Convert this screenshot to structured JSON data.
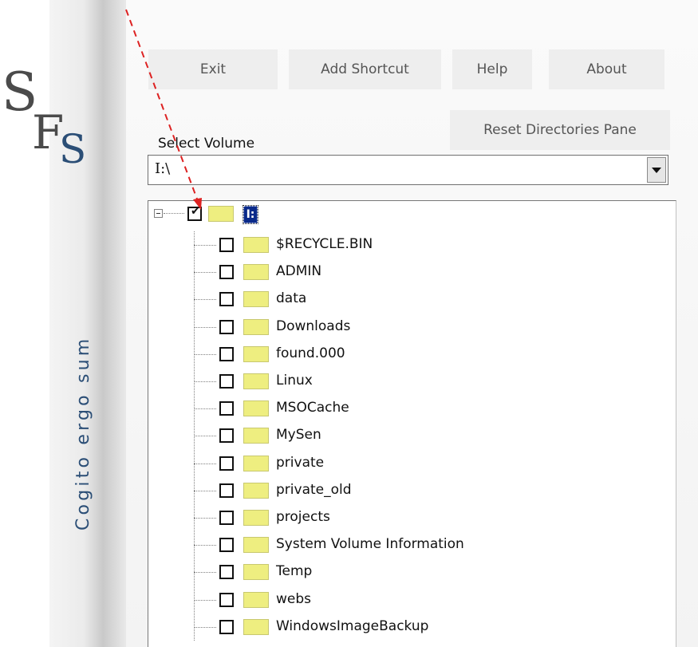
{
  "sidebar": {
    "logo_text": "SFS",
    "tagline": "Cogito ergo sum"
  },
  "toolbar": {
    "exit_label": "Exit",
    "add_shortcut_label": "Add Shortcut",
    "help_label": "Help",
    "about_label": "About",
    "reset_label": "Reset Directories Pane"
  },
  "volume": {
    "label": "Select Volume",
    "value": "I:\\"
  },
  "tree": {
    "root": {
      "label": "I:",
      "checked": true
    },
    "items": [
      {
        "name": "$RECYCLE.BIN"
      },
      {
        "name": "ADMIN"
      },
      {
        "name": "data"
      },
      {
        "name": "Downloads"
      },
      {
        "name": "found.000"
      },
      {
        "name": "Linux"
      },
      {
        "name": "MSOCache"
      },
      {
        "name": "MySen"
      },
      {
        "name": "private"
      },
      {
        "name": "private_old"
      },
      {
        "name": "projects"
      },
      {
        "name": "System Volume Information"
      },
      {
        "name": "Temp"
      },
      {
        "name": "webs"
      },
      {
        "name": "WindowsImageBackup"
      }
    ]
  },
  "colors": {
    "accent": "#2b4e76",
    "annotation_arrow": "#dd2222",
    "folder": "#eeee80",
    "selection": "#0a2a8a"
  }
}
